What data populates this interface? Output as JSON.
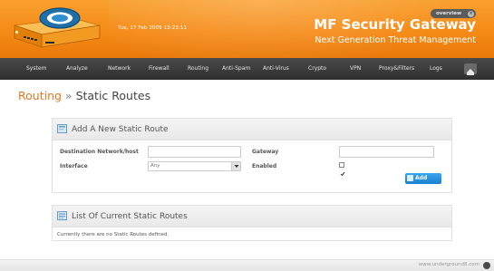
{
  "header": {
    "date_text": "Tue, 17 Feb 2009 13:23:11",
    "overview_label": "overview",
    "brand_title": "MF Security Gateway",
    "brand_subtitle": "Next Generation Threat Management"
  },
  "nav": {
    "items": [
      {
        "label": "System"
      },
      {
        "label": "Analyze"
      },
      {
        "label": "Network"
      },
      {
        "label": "Firewall"
      },
      {
        "label": "Routing"
      },
      {
        "label": "Anti-Spam"
      },
      {
        "label": "Anti-Virus"
      },
      {
        "label": "Crypto"
      },
      {
        "label": "VPN"
      },
      {
        "label": "Proxy&Filters"
      },
      {
        "label": "Logs"
      }
    ]
  },
  "breadcrumb": {
    "section": "Routing",
    "separator": "»",
    "page": "Static Routes"
  },
  "add_panel": {
    "title": "Add A New Static Route",
    "destination_label": "Destination Network/host",
    "destination_value": "",
    "gateway_label": "Gateway",
    "gateway_value": "",
    "interface_label": "Interface",
    "interface_value": "Any",
    "enabled_label": "Enabled",
    "enabled_checked": true,
    "add_button": "Add"
  },
  "list_panel": {
    "title": "List Of Current Static Routes",
    "empty_text": "Currently there are no Static Routes defined."
  },
  "footer": {
    "link_text": "www.underground8.com"
  },
  "colors": {
    "header_orange": "#f58a16",
    "nav_dark": "#333333",
    "breadcrumb_link": "#e87722",
    "button_blue": "#1a7fd0"
  }
}
